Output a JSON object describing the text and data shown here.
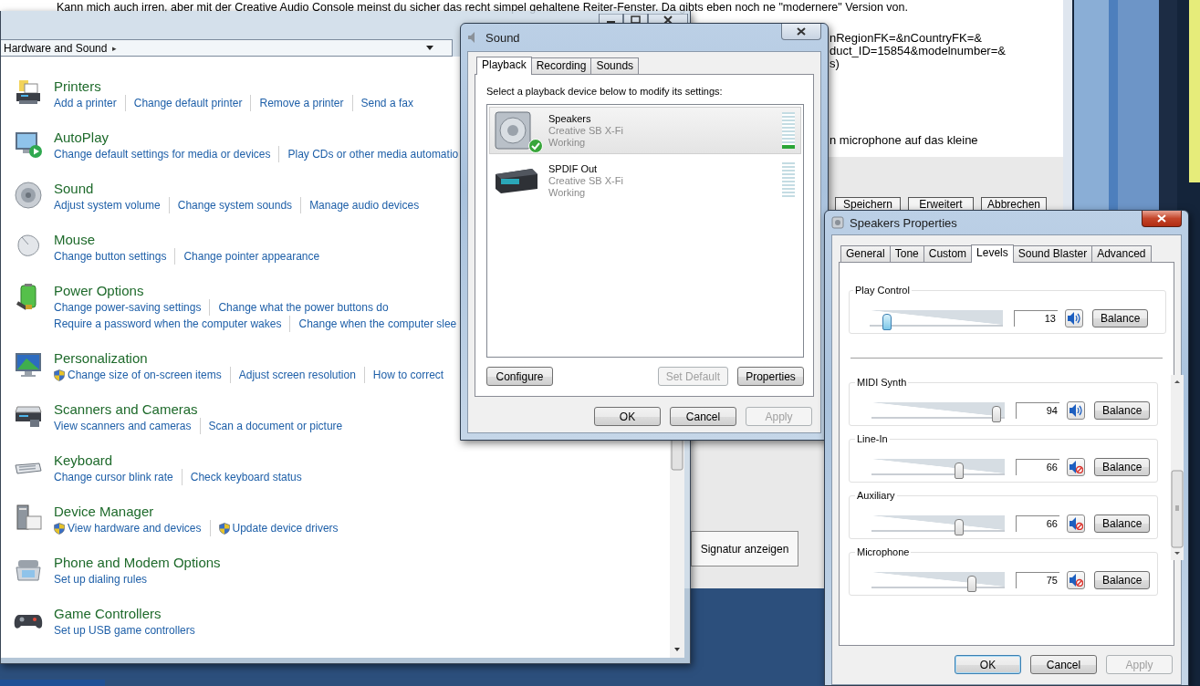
{
  "background_page": {
    "post_text": "Kann mich auch irren, aber mit der Creative Audio Console meinst du sicher das recht simpel gehaltene Reiter-Fenster. Da gibts eben noch ne \"modernere\" Version von.",
    "url_fragments": [
      "nRegionFK=&nCountryFK=&",
      "duct_ID=15854&modelnumber=&",
      "s)"
    ],
    "reply_fragment": "n microphone auf das kleine",
    "form_buttons": [
      "Speichern",
      "Erweitert",
      "Abbrechen"
    ],
    "signature_button": "Signatur anzeigen"
  },
  "control_panel": {
    "breadcrumb": "Hardware and Sound",
    "breadcrumb_arrow": "▸",
    "categories": [
      {
        "title": "Printers",
        "link_lines": [
          [
            {
              "text": "Add a printer",
              "shield": false
            },
            {
              "text": "Change default printer",
              "shield": false
            },
            {
              "text": "Remove a printer",
              "shield": false
            },
            {
              "text": "Send a fax",
              "shield": false
            }
          ]
        ]
      },
      {
        "title": "AutoPlay",
        "link_lines": [
          [
            {
              "text": "Change default settings for media or devices",
              "shield": false
            },
            {
              "text": "Play CDs or other media automatio",
              "shield": false
            }
          ]
        ]
      },
      {
        "title": "Sound",
        "link_lines": [
          [
            {
              "text": "Adjust system volume",
              "shield": false
            },
            {
              "text": "Change system sounds",
              "shield": false
            },
            {
              "text": "Manage audio devices",
              "shield": false
            }
          ]
        ]
      },
      {
        "title": "Mouse",
        "link_lines": [
          [
            {
              "text": "Change button settings",
              "shield": false
            },
            {
              "text": "Change pointer appearance",
              "shield": false
            }
          ]
        ]
      },
      {
        "title": "Power Options",
        "link_lines": [
          [
            {
              "text": "Change power-saving settings",
              "shield": false
            },
            {
              "text": "Change what the power buttons do",
              "shield": false
            }
          ],
          [
            {
              "text": "Require a password when the computer wakes",
              "shield": false
            },
            {
              "text": "Change when the computer slee",
              "shield": false
            }
          ]
        ]
      },
      {
        "title": "Personalization",
        "link_lines": [
          [
            {
              "text": "Change size of on-screen items",
              "shield": true
            },
            {
              "text": "Adjust screen resolution",
              "shield": false
            },
            {
              "text": "How to correct",
              "shield": false
            }
          ]
        ]
      },
      {
        "title": "Scanners and Cameras",
        "link_lines": [
          [
            {
              "text": "View scanners and cameras",
              "shield": false
            },
            {
              "text": "Scan a document or picture",
              "shield": false
            }
          ]
        ]
      },
      {
        "title": "Keyboard",
        "link_lines": [
          [
            {
              "text": "Change cursor blink rate",
              "shield": false
            },
            {
              "text": "Check keyboard status",
              "shield": false
            }
          ]
        ]
      },
      {
        "title": "Device Manager",
        "link_lines": [
          [
            {
              "text": "View hardware and devices",
              "shield": true
            },
            {
              "text": "Update device drivers",
              "shield": true
            }
          ]
        ]
      },
      {
        "title": "Phone and Modem Options",
        "link_lines": [
          [
            {
              "text": "Set up dialing rules",
              "shield": false
            }
          ]
        ]
      },
      {
        "title": "Game Controllers",
        "link_lines": [
          [
            {
              "text": "Set up USB game controllers",
              "shield": false
            }
          ]
        ]
      }
    ]
  },
  "sound_dialog": {
    "title": "Sound",
    "tabs": [
      {
        "label": "Playback",
        "selected": true
      },
      {
        "label": "Recording",
        "selected": false
      },
      {
        "label": "Sounds",
        "selected": false
      }
    ],
    "instruction": "Select a playback device below to modify its settings:",
    "devices": [
      {
        "kind": "speaker",
        "name": "Speakers",
        "description": "Creative SB X-Fi",
        "status": "Working",
        "selected": true,
        "default": true,
        "level": 0.1
      },
      {
        "kind": "digital-output",
        "name": "SPDIF Out",
        "description": "Creative SB X-Fi",
        "status": "Working",
        "selected": false,
        "default": false,
        "level": 0
      }
    ],
    "panel_buttons": [
      {
        "label": "Configure",
        "disabled": false
      },
      {
        "label": "Set Default",
        "disabled": true
      },
      {
        "label": "Properties",
        "disabled": false
      }
    ],
    "buttons": [
      {
        "label": "OK",
        "disabled": false,
        "default": false
      },
      {
        "label": "Cancel",
        "disabled": false,
        "default": false
      },
      {
        "label": "Apply",
        "disabled": true,
        "default": false
      }
    ]
  },
  "properties_dialog": {
    "title": "Speakers Properties",
    "tabs": [
      {
        "label": "General",
        "selected": false
      },
      {
        "label": "Tone",
        "selected": false
      },
      {
        "label": "Custom",
        "selected": false
      },
      {
        "label": "Levels",
        "selected": true
      },
      {
        "label": "Sound Blaster",
        "selected": false
      },
      {
        "label": "Advanced",
        "selected": false
      }
    ],
    "master": {
      "name": "Play Control",
      "level": 0.13,
      "value": "13",
      "muted": false,
      "balance_button": "Balance"
    },
    "channels": [
      {
        "name": "MIDI Synth",
        "level": 0.94,
        "value": "94",
        "muted": false,
        "balance_button": "Balance"
      },
      {
        "name": "Line-In",
        "level": 0.66,
        "value": "66",
        "muted": true,
        "balance_button": "Balance"
      },
      {
        "name": "Auxiliary",
        "level": 0.66,
        "value": "66",
        "muted": true,
        "balance_button": "Balance"
      },
      {
        "name": "Microphone",
        "level": 0.75,
        "value": "75",
        "muted": true,
        "balance_button": "Balance"
      }
    ],
    "buttons": [
      {
        "label": "OK",
        "disabled": false,
        "default": true
      },
      {
        "label": "Cancel",
        "disabled": false,
        "default": false
      },
      {
        "label": "Apply",
        "disabled": true,
        "default": false
      }
    ]
  }
}
